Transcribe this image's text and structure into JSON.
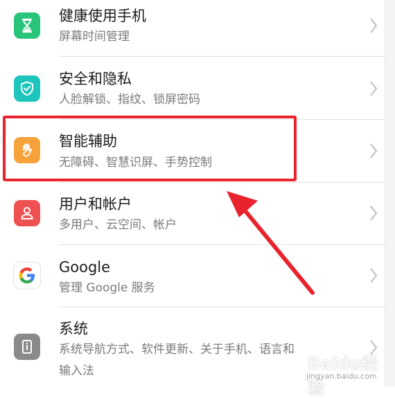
{
  "settings": {
    "items": [
      {
        "title": "健康使用手机",
        "subtitle": "屏幕时间管理",
        "icon": "hourglass-icon",
        "color": "#27c47a"
      },
      {
        "title": "安全和隐私",
        "subtitle": "人脸解锁、指纹、锁屏密码",
        "icon": "shield-check-icon",
        "color": "#1dc5bd"
      },
      {
        "title": "智能辅助",
        "subtitle": "无障碍、智慧识屏、手势控制",
        "icon": "hand-icon",
        "color": "#f7a23a"
      },
      {
        "title": "用户和帐户",
        "subtitle": "多用户、云空间、帐户",
        "icon": "user-icon",
        "color": "#ef5152"
      },
      {
        "title": "Google",
        "subtitle": "管理 Google 服务",
        "icon": "google-icon",
        "color": "#ffffff"
      },
      {
        "title": "系统",
        "subtitle": "系统导航方式、软件更新、关于手机、语言和",
        "subtitle2": "输入法",
        "icon": "phone-info-icon",
        "color": "#8a8a8a"
      }
    ]
  },
  "annotation": {
    "highlight_color": "#e8232d"
  },
  "watermark": {
    "logo": "Baidu经验",
    "url": "jingyan.baidu.com"
  }
}
